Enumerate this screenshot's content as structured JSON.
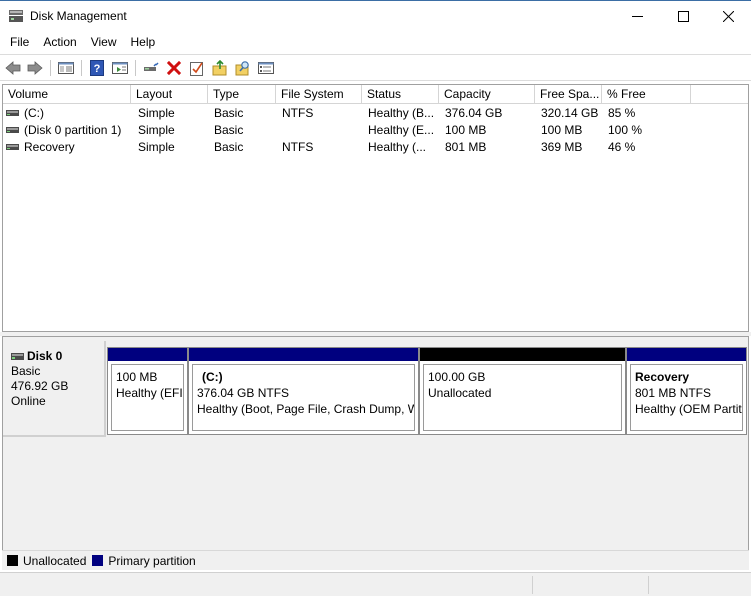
{
  "window": {
    "title": "Disk Management"
  },
  "menu": [
    {
      "label": "File"
    },
    {
      "label": "Action"
    },
    {
      "label": "View"
    },
    {
      "label": "Help"
    }
  ],
  "toolbar": {
    "icons": [
      "back-icon",
      "forward-icon",
      "console-tree-icon",
      "help-icon",
      "show-pane-icon",
      "connect-icon",
      "delete-icon",
      "checklist-icon",
      "new-folder-icon",
      "search-icon",
      "properties-icon"
    ]
  },
  "volume_list": {
    "columns": [
      "Volume",
      "Layout",
      "Type",
      "File System",
      "Status",
      "Capacity",
      "Free Spa...",
      "% Free"
    ],
    "rows": [
      {
        "volume": " (C:)",
        "layout": "Simple",
        "type": "Basic",
        "fs": "NTFS",
        "status": "Healthy (B...",
        "capacity": "376.04 GB",
        "free": "320.14 GB",
        "pct": "85 %"
      },
      {
        "volume": "(Disk 0 partition 1)",
        "layout": "Simple",
        "type": "Basic",
        "fs": "",
        "status": "Healthy (E...",
        "capacity": "100 MB",
        "free": "100 MB",
        "pct": "100 %"
      },
      {
        "volume": "Recovery",
        "layout": "Simple",
        "type": "Basic",
        "fs": "NTFS",
        "status": "Healthy (...",
        "capacity": "801 MB",
        "free": "369 MB",
        "pct": "46 %"
      }
    ]
  },
  "disk": {
    "name": "Disk 0",
    "type": "Basic",
    "size": "476.92 GB",
    "state": "Online",
    "partitions": [
      {
        "name": "",
        "size": "100 MB",
        "status": "Healthy (EFI",
        "bar_color": "#00007f"
      },
      {
        "name": "(C:)",
        "size": "376.04 GB NTFS",
        "status": "Healthy (Boot, Page File, Crash Dump, W",
        "bar_color": "#00007f"
      },
      {
        "name": "",
        "size": "100.00 GB",
        "status": "Unallocated",
        "bar_color": "#000000"
      },
      {
        "name": "Recovery",
        "size": "801 MB NTFS",
        "status": "Healthy (OEM Partit",
        "bar_color": "#00007f"
      }
    ]
  },
  "legend": [
    {
      "label": "Unallocated",
      "color": "#000000"
    },
    {
      "label": "Primary partition",
      "color": "#00007f"
    }
  ]
}
